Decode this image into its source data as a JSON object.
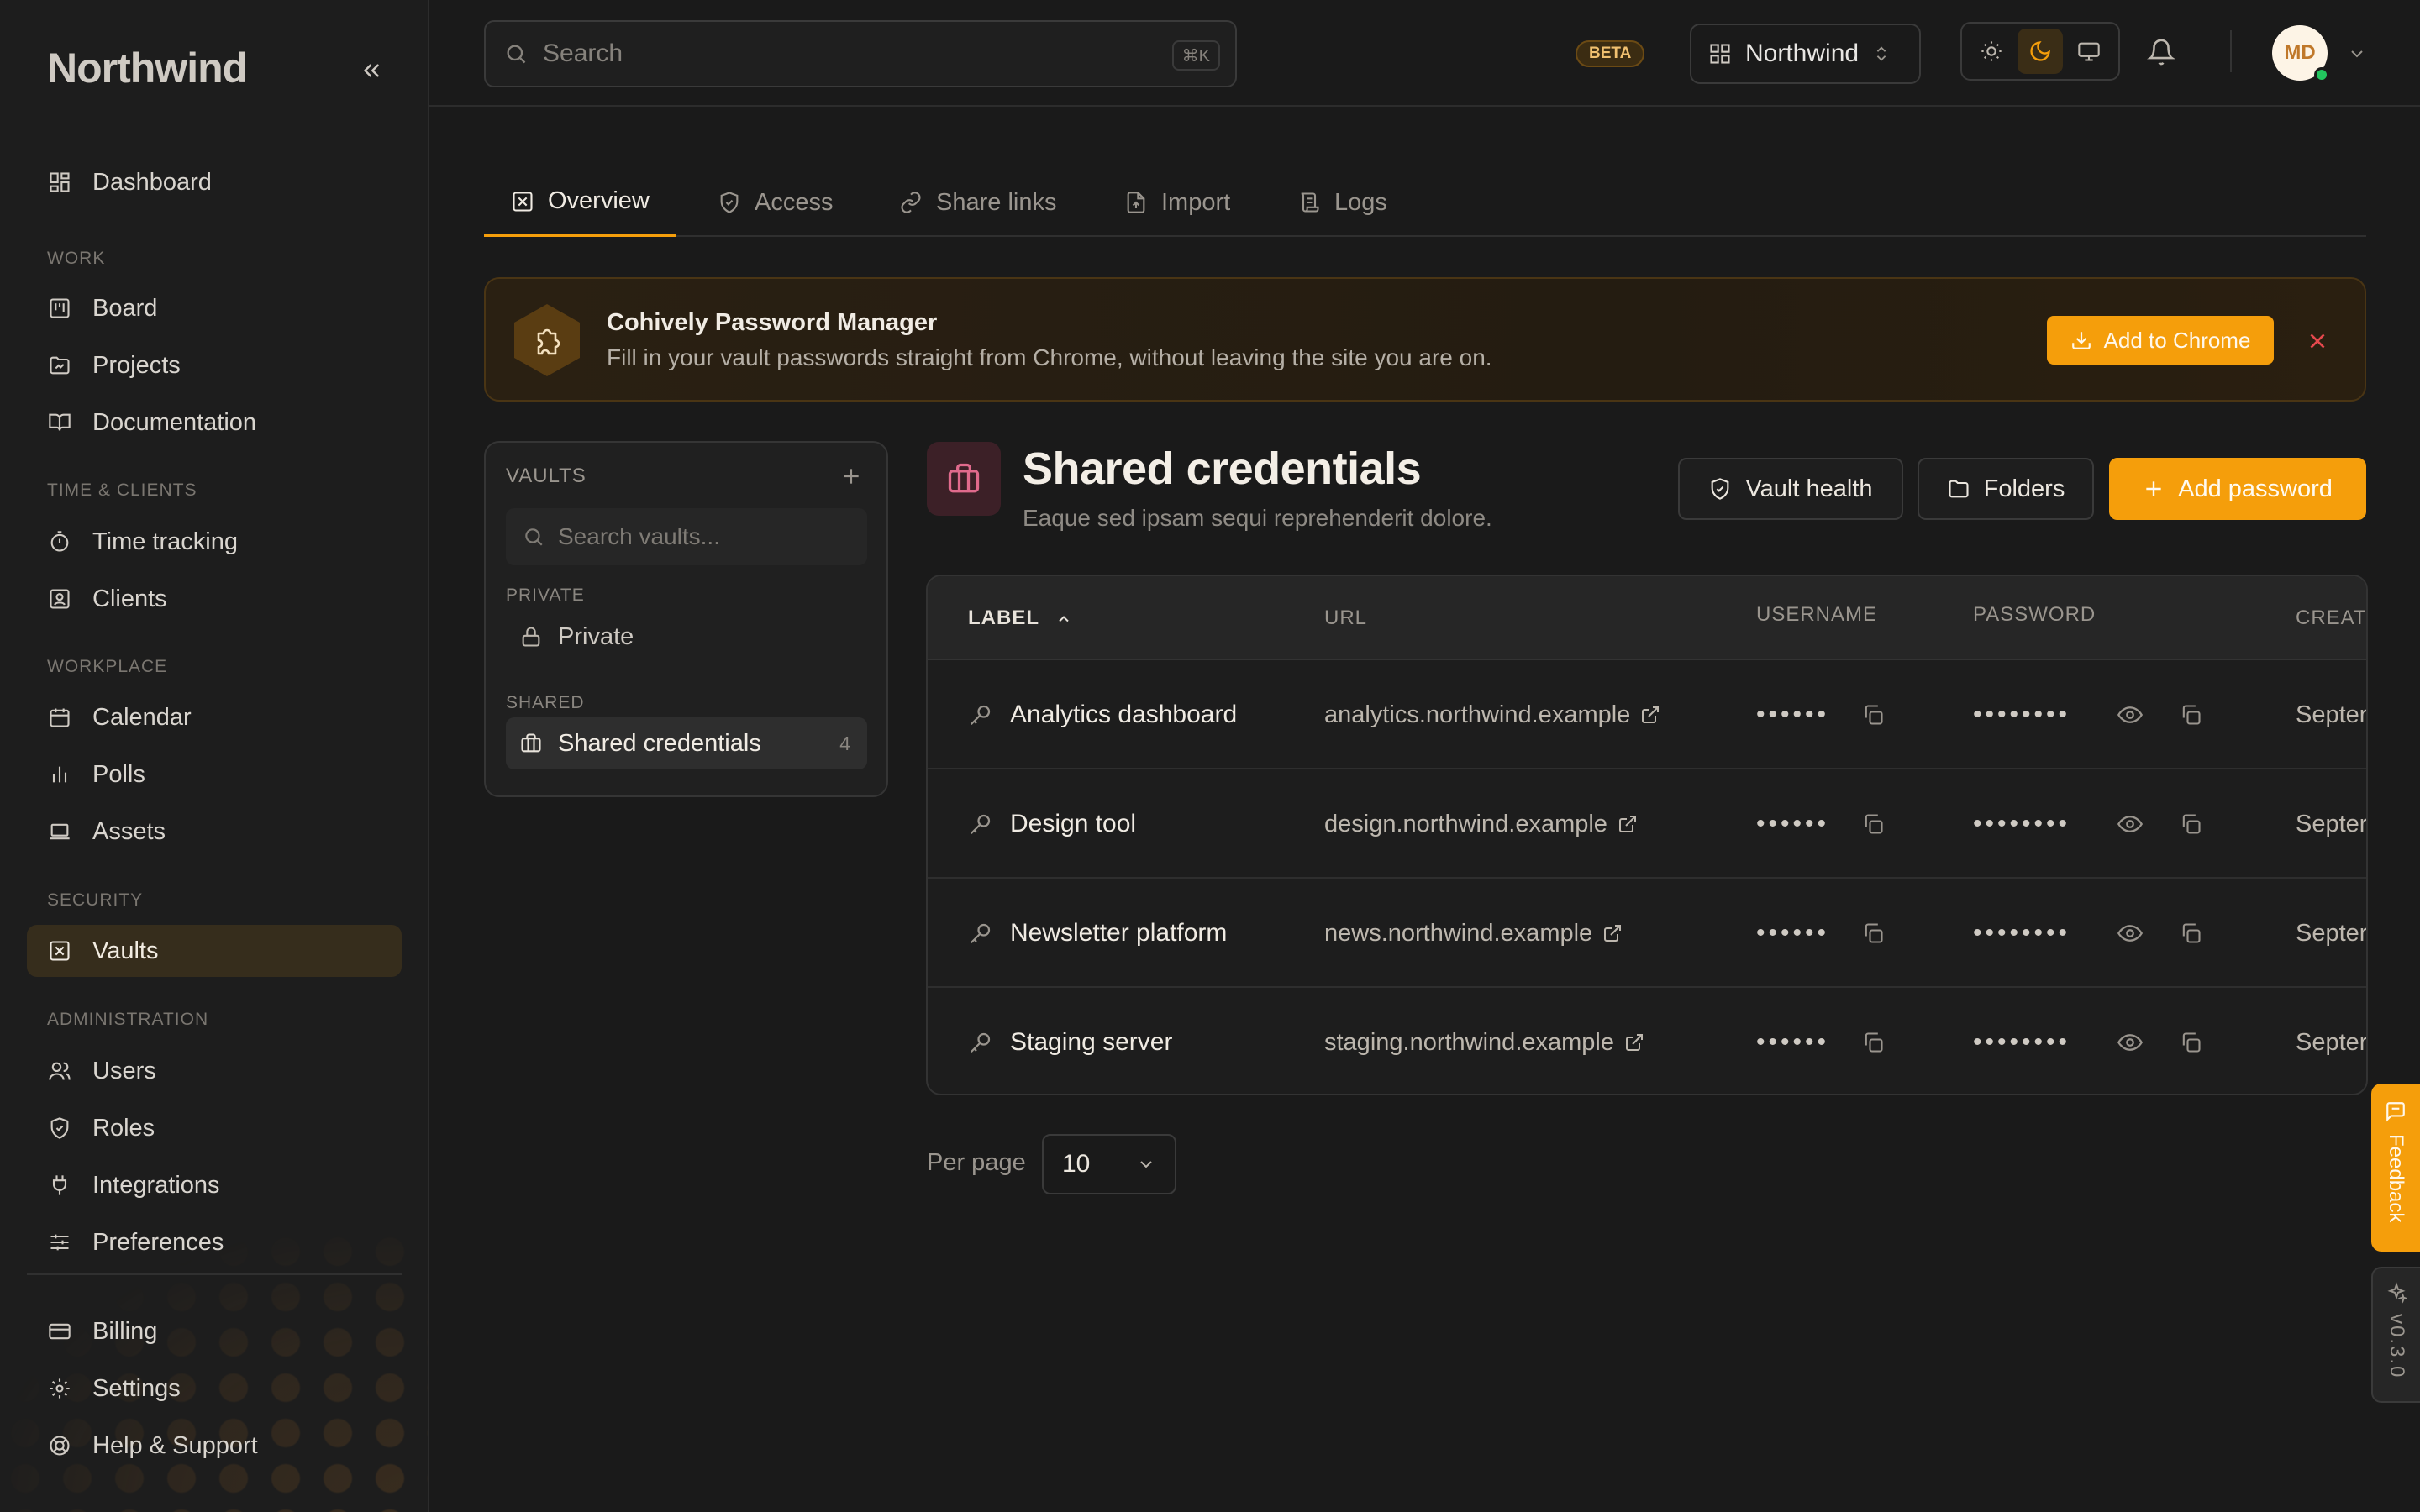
{
  "app": {
    "brand": "Northwind"
  },
  "sidebar": {
    "items": {
      "dashboard": "Dashboard",
      "board": "Board",
      "projects": "Projects",
      "documentation": "Documentation",
      "time_tracking": "Time tracking",
      "clients": "Clients",
      "calendar": "Calendar",
      "polls": "Polls",
      "assets": "Assets",
      "vaults": "Vaults",
      "users": "Users",
      "roles": "Roles",
      "integrations": "Integrations",
      "preferences": "Preferences",
      "billing": "Billing",
      "settings": "Settings",
      "help": "Help & Support"
    },
    "sections": {
      "work": "WORK",
      "time_clients": "TIME & CLIENTS",
      "workplace": "WORKPLACE",
      "security": "SECURITY",
      "administration": "ADMINISTRATION"
    },
    "active": "vaults"
  },
  "topbar": {
    "search_placeholder": "Search",
    "search_shortcut": "⌘K",
    "beta": "BETA",
    "workspace": "Northwind",
    "theme_active": "dark",
    "avatar_initials": "MD"
  },
  "tabs": {
    "overview": "Overview",
    "access": "Access",
    "share_links": "Share links",
    "import": "Import",
    "logs": "Logs"
  },
  "banner": {
    "title": "Cohively Password Manager",
    "subtitle": "Fill in your vault passwords straight from Chrome, without leaving the site you are on.",
    "cta": "Add to Chrome"
  },
  "vaults_panel": {
    "header": "VAULTS",
    "search_placeholder": "Search vaults...",
    "group_private": "PRIVATE",
    "group_shared": "SHARED",
    "private_item": "Private",
    "shared_item": "Shared credentials",
    "shared_count": "4"
  },
  "vault": {
    "title": "Shared credentials",
    "description": "Eaque sed ipsam sequi reprehenderit dolore.",
    "btn_health": "Vault health",
    "btn_folders": "Folders",
    "btn_add": "Add password"
  },
  "table": {
    "headers": {
      "label": "LABEL",
      "url": "URL",
      "username": "USERNAME",
      "password": "PASSWORD",
      "created": "CREATE"
    },
    "sort": {
      "column": "label",
      "direction": "asc"
    },
    "rows": [
      {
        "label": "Analytics dashboard",
        "url": "analytics.northwind.example",
        "username_mask": "••••••",
        "password_mask": "••••••••",
        "created": "Septer"
      },
      {
        "label": "Design tool",
        "url": "design.northwind.example",
        "username_mask": "••••••",
        "password_mask": "••••••••",
        "created": "Septer"
      },
      {
        "label": "Newsletter platform",
        "url": "news.northwind.example",
        "username_mask": "••••••",
        "password_mask": "••••••••",
        "created": "Septer"
      },
      {
        "label": "Staging server",
        "url": "staging.northwind.example",
        "username_mask": "••••••",
        "password_mask": "••••••••",
        "created": "Septer"
      }
    ]
  },
  "pagination": {
    "per_page_label": "Per page",
    "per_page_value": "10"
  },
  "side_tabs": {
    "feedback": "Feedback",
    "version": "v0.3.0"
  },
  "colors": {
    "accent": "#f59e0b",
    "background": "#1a1a1a",
    "sidebar": "#1d1d1d",
    "active_nav": "#362d1c",
    "close_red": "#e5484d"
  }
}
